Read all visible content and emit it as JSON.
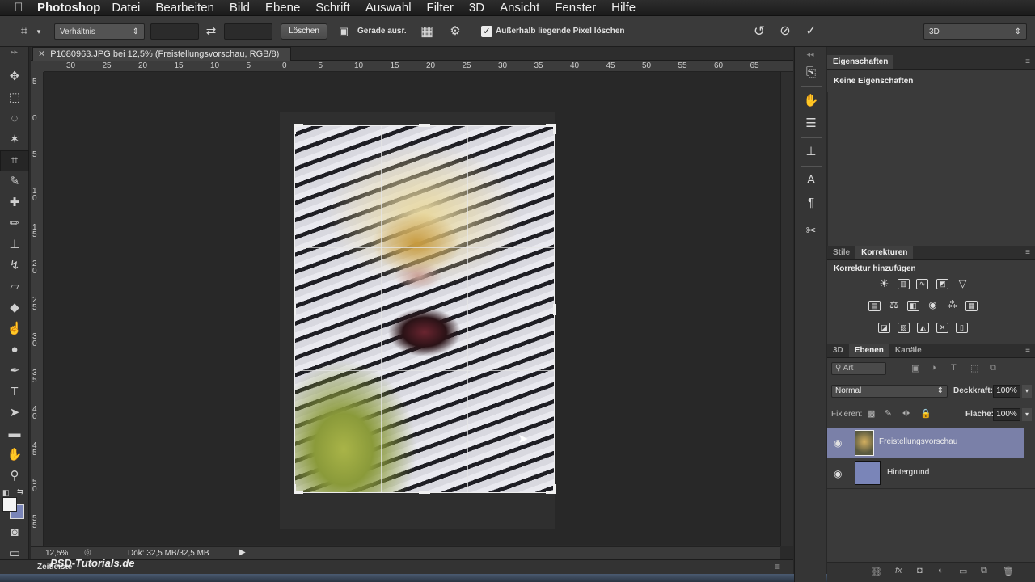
{
  "menubar": {
    "apple": "",
    "app": "Photoshop",
    "items": [
      "Datei",
      "Bearbeiten",
      "Bild",
      "Ebene",
      "Schrift",
      "Auswahl",
      "Filter",
      "3D",
      "Ansicht",
      "Fenster",
      "Hilfe"
    ]
  },
  "options": {
    "ratio": "Verhältnis",
    "clear": "Löschen",
    "straighten": "Gerade ausr.",
    "delete_pixels": "Außerhalb liegende Pixel löschen",
    "workspace": "3D",
    "checked": true
  },
  "document": {
    "tab_title": "P1080963.JPG bei 12,5% (Freistellungsvorschau, RGB/8)",
    "ruler_h": [
      "30",
      "25",
      "20",
      "15",
      "10",
      "5",
      "0",
      "5",
      "10",
      "15",
      "20",
      "25",
      "30",
      "35",
      "40",
      "45",
      "50",
      "55",
      "60",
      "65"
    ],
    "ruler_v": [
      "5",
      "0",
      "5",
      "1 0",
      "1 5",
      "2 0",
      "2 5",
      "3 0",
      "3 5",
      "4 0",
      "4 5",
      "5 0",
      "5 5"
    ]
  },
  "status": {
    "zoom": "12,5%",
    "doc": "Dok: 32,5 MB/32,5 MB"
  },
  "timeline": {
    "label": "Zeitleiste"
  },
  "watermark": "PSD-Tutorials.de",
  "properties": {
    "tab": "Eigenschaften",
    "empty": "Keine Eigenschaften"
  },
  "adjustments": {
    "tabs": [
      "Stile",
      "Korrekturen"
    ],
    "title": "Korrektur hinzufügen"
  },
  "layers": {
    "tabs": [
      "3D",
      "Ebenen",
      "Kanäle"
    ],
    "filter": "Art",
    "blend": "Normal",
    "opacity_label": "Deckkraft:",
    "opacity": "100%",
    "lock_label": "Fixieren:",
    "fill_label": "Fläche:",
    "fill": "100%",
    "items": [
      {
        "name": "Freistellungsvorschau",
        "selected": true
      },
      {
        "name": "Hintergrund",
        "selected": false
      }
    ]
  },
  "colors": {
    "accent": "#7a85b8",
    "selected_layer": "#7a80a8"
  }
}
